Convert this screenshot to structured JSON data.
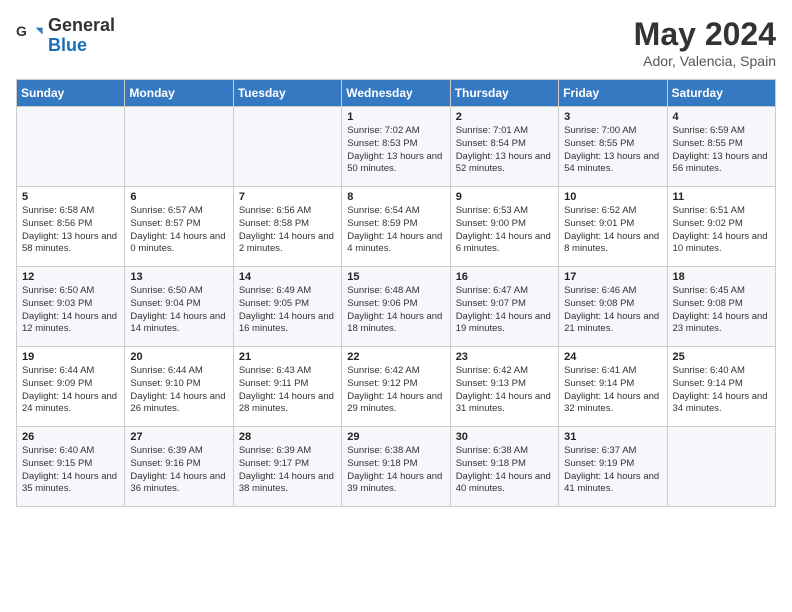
{
  "header": {
    "logo_text_general": "General",
    "logo_text_blue": "Blue",
    "month_year": "May 2024",
    "location": "Ador, Valencia, Spain"
  },
  "days_of_week": [
    "Sunday",
    "Monday",
    "Tuesday",
    "Wednesday",
    "Thursday",
    "Friday",
    "Saturday"
  ],
  "weeks": [
    [
      {
        "day": "",
        "sunrise": "",
        "sunset": "",
        "daylight": ""
      },
      {
        "day": "",
        "sunrise": "",
        "sunset": "",
        "daylight": ""
      },
      {
        "day": "",
        "sunrise": "",
        "sunset": "",
        "daylight": ""
      },
      {
        "day": "1",
        "sunrise": "Sunrise: 7:02 AM",
        "sunset": "Sunset: 8:53 PM",
        "daylight": "Daylight: 13 hours and 50 minutes."
      },
      {
        "day": "2",
        "sunrise": "Sunrise: 7:01 AM",
        "sunset": "Sunset: 8:54 PM",
        "daylight": "Daylight: 13 hours and 52 minutes."
      },
      {
        "day": "3",
        "sunrise": "Sunrise: 7:00 AM",
        "sunset": "Sunset: 8:55 PM",
        "daylight": "Daylight: 13 hours and 54 minutes."
      },
      {
        "day": "4",
        "sunrise": "Sunrise: 6:59 AM",
        "sunset": "Sunset: 8:55 PM",
        "daylight": "Daylight: 13 hours and 56 minutes."
      }
    ],
    [
      {
        "day": "5",
        "sunrise": "Sunrise: 6:58 AM",
        "sunset": "Sunset: 8:56 PM",
        "daylight": "Daylight: 13 hours and 58 minutes."
      },
      {
        "day": "6",
        "sunrise": "Sunrise: 6:57 AM",
        "sunset": "Sunset: 8:57 PM",
        "daylight": "Daylight: 14 hours and 0 minutes."
      },
      {
        "day": "7",
        "sunrise": "Sunrise: 6:56 AM",
        "sunset": "Sunset: 8:58 PM",
        "daylight": "Daylight: 14 hours and 2 minutes."
      },
      {
        "day": "8",
        "sunrise": "Sunrise: 6:54 AM",
        "sunset": "Sunset: 8:59 PM",
        "daylight": "Daylight: 14 hours and 4 minutes."
      },
      {
        "day": "9",
        "sunrise": "Sunrise: 6:53 AM",
        "sunset": "Sunset: 9:00 PM",
        "daylight": "Daylight: 14 hours and 6 minutes."
      },
      {
        "day": "10",
        "sunrise": "Sunrise: 6:52 AM",
        "sunset": "Sunset: 9:01 PM",
        "daylight": "Daylight: 14 hours and 8 minutes."
      },
      {
        "day": "11",
        "sunrise": "Sunrise: 6:51 AM",
        "sunset": "Sunset: 9:02 PM",
        "daylight": "Daylight: 14 hours and 10 minutes."
      }
    ],
    [
      {
        "day": "12",
        "sunrise": "Sunrise: 6:50 AM",
        "sunset": "Sunset: 9:03 PM",
        "daylight": "Daylight: 14 hours and 12 minutes."
      },
      {
        "day": "13",
        "sunrise": "Sunrise: 6:50 AM",
        "sunset": "Sunset: 9:04 PM",
        "daylight": "Daylight: 14 hours and 14 minutes."
      },
      {
        "day": "14",
        "sunrise": "Sunrise: 6:49 AM",
        "sunset": "Sunset: 9:05 PM",
        "daylight": "Daylight: 14 hours and 16 minutes."
      },
      {
        "day": "15",
        "sunrise": "Sunrise: 6:48 AM",
        "sunset": "Sunset: 9:06 PM",
        "daylight": "Daylight: 14 hours and 18 minutes."
      },
      {
        "day": "16",
        "sunrise": "Sunrise: 6:47 AM",
        "sunset": "Sunset: 9:07 PM",
        "daylight": "Daylight: 14 hours and 19 minutes."
      },
      {
        "day": "17",
        "sunrise": "Sunrise: 6:46 AM",
        "sunset": "Sunset: 9:08 PM",
        "daylight": "Daylight: 14 hours and 21 minutes."
      },
      {
        "day": "18",
        "sunrise": "Sunrise: 6:45 AM",
        "sunset": "Sunset: 9:08 PM",
        "daylight": "Daylight: 14 hours and 23 minutes."
      }
    ],
    [
      {
        "day": "19",
        "sunrise": "Sunrise: 6:44 AM",
        "sunset": "Sunset: 9:09 PM",
        "daylight": "Daylight: 14 hours and 24 minutes."
      },
      {
        "day": "20",
        "sunrise": "Sunrise: 6:44 AM",
        "sunset": "Sunset: 9:10 PM",
        "daylight": "Daylight: 14 hours and 26 minutes."
      },
      {
        "day": "21",
        "sunrise": "Sunrise: 6:43 AM",
        "sunset": "Sunset: 9:11 PM",
        "daylight": "Daylight: 14 hours and 28 minutes."
      },
      {
        "day": "22",
        "sunrise": "Sunrise: 6:42 AM",
        "sunset": "Sunset: 9:12 PM",
        "daylight": "Daylight: 14 hours and 29 minutes."
      },
      {
        "day": "23",
        "sunrise": "Sunrise: 6:42 AM",
        "sunset": "Sunset: 9:13 PM",
        "daylight": "Daylight: 14 hours and 31 minutes."
      },
      {
        "day": "24",
        "sunrise": "Sunrise: 6:41 AM",
        "sunset": "Sunset: 9:14 PM",
        "daylight": "Daylight: 14 hours and 32 minutes."
      },
      {
        "day": "25",
        "sunrise": "Sunrise: 6:40 AM",
        "sunset": "Sunset: 9:14 PM",
        "daylight": "Daylight: 14 hours and 34 minutes."
      }
    ],
    [
      {
        "day": "26",
        "sunrise": "Sunrise: 6:40 AM",
        "sunset": "Sunset: 9:15 PM",
        "daylight": "Daylight: 14 hours and 35 minutes."
      },
      {
        "day": "27",
        "sunrise": "Sunrise: 6:39 AM",
        "sunset": "Sunset: 9:16 PM",
        "daylight": "Daylight: 14 hours and 36 minutes."
      },
      {
        "day": "28",
        "sunrise": "Sunrise: 6:39 AM",
        "sunset": "Sunset: 9:17 PM",
        "daylight": "Daylight: 14 hours and 38 minutes."
      },
      {
        "day": "29",
        "sunrise": "Sunrise: 6:38 AM",
        "sunset": "Sunset: 9:18 PM",
        "daylight": "Daylight: 14 hours and 39 minutes."
      },
      {
        "day": "30",
        "sunrise": "Sunrise: 6:38 AM",
        "sunset": "Sunset: 9:18 PM",
        "daylight": "Daylight: 14 hours and 40 minutes."
      },
      {
        "day": "31",
        "sunrise": "Sunrise: 6:37 AM",
        "sunset": "Sunset: 9:19 PM",
        "daylight": "Daylight: 14 hours and 41 minutes."
      },
      {
        "day": "",
        "sunrise": "",
        "sunset": "",
        "daylight": ""
      }
    ]
  ]
}
